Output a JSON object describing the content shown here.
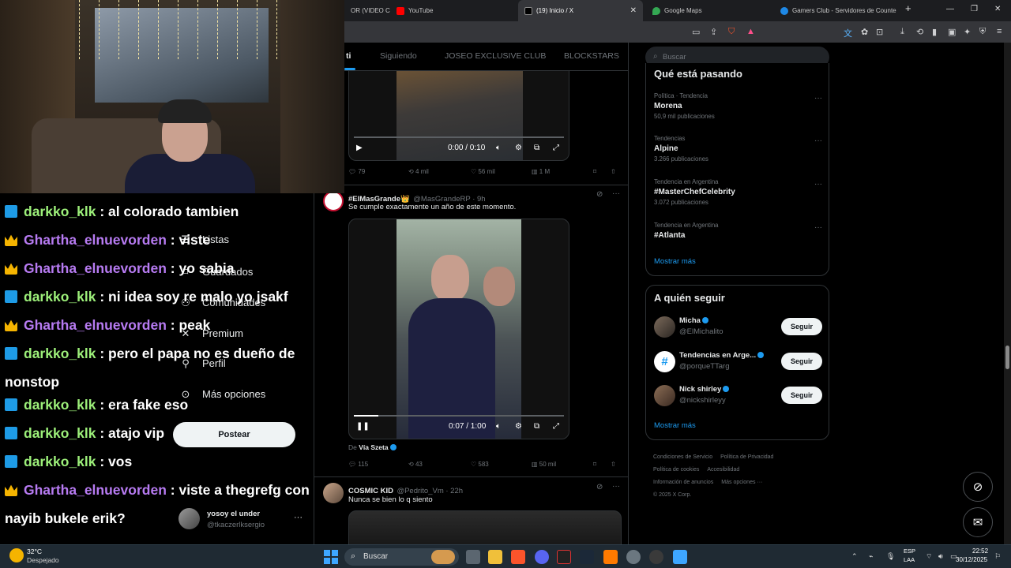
{
  "browser": {
    "tabs": [
      {
        "label": "OR (VIDEO C",
        "active": false
      },
      {
        "label": "YouTube",
        "active": false
      },
      {
        "label": "(19) Inicio / X",
        "active": true
      },
      {
        "label": "Google Maps",
        "active": false
      },
      {
        "label": "Gamers Club - Servidores de Counte",
        "active": false
      }
    ],
    "tab_close": "✕",
    "new_tab": "+",
    "window_controls": [
      "—",
      "❐",
      "✕"
    ],
    "colors": {
      "tabbar": "#1c1d20",
      "toolbar": "#35363a"
    }
  },
  "chat": {
    "messages": [
      {
        "user": "darkko_klk",
        "color": "green",
        "badge": "blue",
        "text": ": al colorado tambien"
      },
      {
        "user": "Ghartha_elnuevorden",
        "color": "purple",
        "badge": "crown",
        "text": ": viste"
      },
      {
        "user": "Ghartha_elnuevorden",
        "color": "purple",
        "badge": "crown",
        "text": ": yo sabia"
      },
      {
        "user": "darkko_klk",
        "color": "green",
        "badge": "blue",
        "text": ": ni idea soy re malo yo jsakf"
      },
      {
        "user": "Ghartha_elnuevorden",
        "color": "purple",
        "badge": "crown",
        "text": ": peak"
      },
      {
        "user": "darkko_klk",
        "color": "green",
        "badge": "blue",
        "text": ": pero el papa no es dueño de nonstop"
      },
      {
        "user": "darkko_klk",
        "color": "green",
        "badge": "blue",
        "text": ": era fake eso"
      },
      {
        "user": "darkko_klk",
        "color": "green",
        "badge": "blue",
        "text": ": atajo vip"
      },
      {
        "user": "darkko_klk",
        "color": "green",
        "badge": "blue",
        "text": ": vos"
      },
      {
        "user": "Ghartha_elnuevorden",
        "color": "purple",
        "badge": "crown",
        "text": ": viste a thegrefg con nayib bukele erik?"
      }
    ]
  },
  "x_nav": {
    "items": [
      {
        "label": "Listas",
        "icon": "list-icon"
      },
      {
        "label": "Guardados",
        "icon": "bookmark-icon"
      },
      {
        "label": "Comunidades",
        "icon": "communities-icon"
      },
      {
        "label": "Premium",
        "icon": "x-logo-icon"
      },
      {
        "label": "Perfil",
        "icon": "profile-icon"
      },
      {
        "label": "Más opciones",
        "icon": "more-options-icon"
      }
    ],
    "post_button": "Postear",
    "account": {
      "name": "yosoy el under",
      "handle": "@tkaczerlksergio",
      "more": "···"
    }
  },
  "timeline": {
    "tabs": [
      {
        "label": "ti",
        "active": true
      },
      {
        "label": "Siguiendo",
        "active": false
      },
      {
        "label": "JOSEO EXCLUSIVE CLUB",
        "active": false
      },
      {
        "label": "BLOCKSTARS",
        "active": false
      }
    ],
    "tweet1": {
      "video_time": "0:00 / 0:10",
      "video_progress": 0,
      "replies": "79",
      "reposts": "4 mil",
      "likes": "56 mil",
      "views": "1 M"
    },
    "tweet2": {
      "name": "#ElMasGrande👑",
      "handle": "@MasGrandeRP · 9h",
      "text": "Se cumple exactamente un año de este momento.",
      "video_time": "0:07 / 1:00",
      "video_progress": 0.117,
      "via_prefix": "De",
      "via_name": "Vía Szeta",
      "replies": "115",
      "reposts": "43",
      "likes": "583",
      "views": "50 mil"
    },
    "tweet3": {
      "name": "COSMIC KID",
      "handle": "@Pedrito_Vm · 22h",
      "text": "Nunca se bien lo q siento"
    }
  },
  "right": {
    "search_placeholder": "Buscar",
    "trends_title": "Qué está pasando",
    "trends": [
      {
        "category": "Política · Tendencia",
        "name": "Morena",
        "count": "50,9 mil publicaciones"
      },
      {
        "category": "Tendencias",
        "name": "Alpine",
        "count": "3.266 publicaciones"
      },
      {
        "category": "Tendencia en Argentina",
        "name": "#MasterChefCelebrity",
        "count": "3.072 publicaciones"
      },
      {
        "category": "Tendencia en Argentina",
        "name": "#Atlanta",
        "count": ""
      }
    ],
    "show_more": "Mostrar más",
    "follow_title": "A quién seguir",
    "follow": [
      {
        "name": "Micha",
        "handle": "@ElMichalito",
        "button": "Seguir"
      },
      {
        "name": "Tendencias en Arge...",
        "handle": "@porqueTTarg",
        "button": "Seguir"
      },
      {
        "name": "Nick shirley",
        "handle": "@nickshirleyy",
        "button": "Seguir"
      }
    ],
    "footer": [
      "Condiciones de Servicio",
      "Política de Privacidad",
      "Política de cookies",
      "Accesibilidad",
      "Información de anuncios",
      "Más opciones ···",
      "© 2025 X Corp."
    ]
  },
  "taskbar": {
    "weather_temp": "32°C",
    "weather_desc": "Despejado",
    "search_label": "Buscar",
    "lang": "ESP",
    "lang2": "LAA",
    "time": "22:52",
    "date": "30/12/2025"
  }
}
